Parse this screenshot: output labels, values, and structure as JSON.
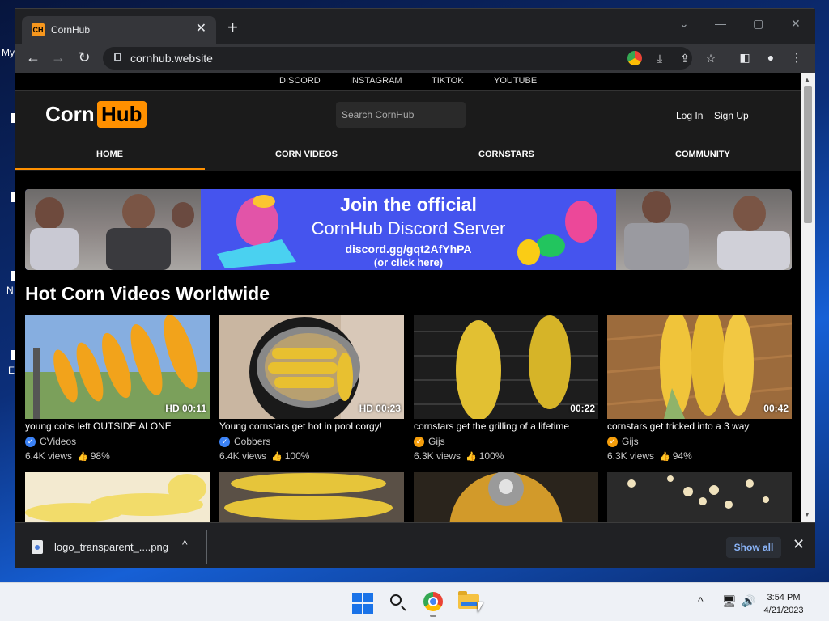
{
  "desktop": {
    "labels": [
      "My",
      "N",
      "E"
    ]
  },
  "browser": {
    "tab_title": "CornHub",
    "tab_favicon_text": "CH",
    "url": "cornhub.website",
    "window_controls": {
      "dropdown": "⌄",
      "minimize": "—",
      "maximize": "▢",
      "close": "✕"
    }
  },
  "site": {
    "social": [
      "DISCORD",
      "INSTAGRAM",
      "TIKTOK",
      "YOUTUBE"
    ],
    "logo_left": "Corn",
    "logo_right": "Hub",
    "search_placeholder": "Search CornHub",
    "login": "Log In",
    "signup": "Sign Up",
    "nav": [
      "HOME",
      "CORN VIDEOS",
      "CORNSTARS",
      "COMMUNITY"
    ],
    "active_nav": "HOME",
    "accent_color": "#ff9000",
    "banner": {
      "line1": "Join the official",
      "line2": "CornHub Discord Server",
      "line3": "discord.gg/gqt2AfYhPA",
      "line4": "(or click here)"
    },
    "section_title": "Hot Corn Videos Worldwide",
    "videos": [
      {
        "title": "young cobs left OUTSIDE ALONE",
        "channel": "CVideos",
        "badge": "blue",
        "views": "6.4K views",
        "rating": "98%",
        "duration": "HD 00:11"
      },
      {
        "title": "Young cornstars get hot in pool corgy!",
        "channel": "Cobbers",
        "badge": "blue",
        "views": "6.4K views",
        "rating": "100%",
        "duration": "HD 00:23"
      },
      {
        "title": "cornstars get the grilling of a lifetime",
        "channel": "Gijs",
        "badge": "orange",
        "views": "6.3K views",
        "rating": "100%",
        "duration": "00:22"
      },
      {
        "title": "cornstars get tricked into a 3 way",
        "channel": "Gijs",
        "badge": "orange",
        "views": "6.3K views",
        "rating": "94%",
        "duration": "00:42"
      }
    ]
  },
  "downloads": {
    "file_name": "logo_transparent_....png",
    "show_all": "Show all"
  },
  "taskbar": {
    "time": "3:54 PM",
    "date": "4/21/2023"
  }
}
